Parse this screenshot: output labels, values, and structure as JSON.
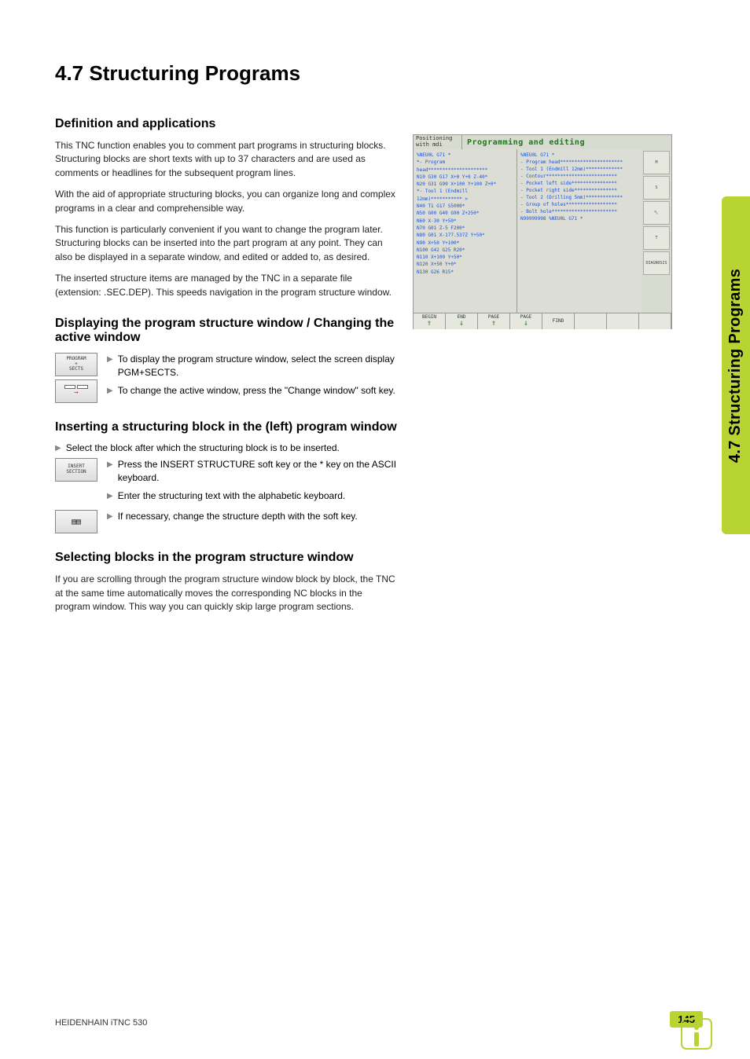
{
  "side_tab": "4.7 Structuring Programs",
  "h1": "4.7  Structuring Programs",
  "sections": {
    "def": {
      "title": "Definition and applications",
      "p1": "This TNC function enables you to comment part programs in structuring blocks. Structuring blocks are short texts with up to 37 characters and are used as comments or headlines for the subsequent program lines.",
      "p2": "With the aid of appropriate structuring blocks, you can organize long and complex programs in a clear and comprehensible way.",
      "p3": "This function is particularly convenient if you want to change the program later. Structuring blocks can be inserted into the part program at any point. They can also be displayed in a separate window, and edited or added to, as desired.",
      "p4": "The inserted structure items are managed by the TNC in a separate file (extension: .SEC.DEP). This speeds navigation in the program structure window."
    },
    "disp": {
      "title": "Displaying the program structure window / Changing the active window",
      "softkey1": "PROGRAM\n+\nSECTS",
      "items": [
        "To display the program structure window, select the screen display PGM+SECTS.",
        "To change the active window, press the \"Change window\" soft key."
      ]
    },
    "insert": {
      "title": "Inserting a structuring block in the (left) program window",
      "lead": "Select the block after which the structuring block is to be inserted.",
      "softkey1": "INSERT\nSECTION",
      "items": [
        "Press the INSERT STRUCTURE soft key or the * key on the ASCII keyboard.",
        "Enter the structuring text with the alphabetic keyboard.",
        "If necessary, change the structure depth with the soft key."
      ]
    },
    "select": {
      "title": "Selecting blocks in the program structure window",
      "p1": "If you are scrolling through the program structure window block by block, the TNC at the same time automatically moves the corresponding NC blocks in the program window. This way you can quickly skip large program sections."
    }
  },
  "footer": {
    "product": "HEIDENHAIN iTNC 530",
    "page": "145"
  },
  "screenshot": {
    "mode": "Positioning with mdi",
    "title": "Programming and editing",
    "left_lines": [
      "%NEU0L G71 *",
      "*- Program head*********************",
      "N10 G30 G17 X+0 Y+0 Z-40*",
      "N20 G31 G90 X+100 Y+100 Z+0*",
      "*- Tool 1 (Endmill 12mm)*********** >",
      "N40 T1 G17 S5000*",
      "N50 G00 G40 G90 Z+250*",
      "N60 X-30 Y+50*",
      "N70 G01 Z-5 F200*",
      "N80 G01 X-177.537Z Y+50*",
      "N90 X+50 Y+100*",
      "N100 G42 G25 R20*",
      "N110 X+100 Y+50*",
      "N120 X+50 Y+0*",
      "N130 G26 R15*"
    ],
    "mid_lines": [
      "%NEU0L G71 *",
      "- Program head**********************",
      "- Tool 1 (Endmill 12mm)*************",
      "  - Contour*************************",
      "  - Pocket left side****************",
      "  - Pocket right side***************",
      "- Tool 2 (Drilling 5mm)*************",
      "  - Group of holes******************",
      "  - Bolt hole***********************",
      "N99999998 %NEU0L G71 *"
    ],
    "right_buttons": [
      "M",
      "S",
      "🔧",
      "T",
      "DIAGNOSIS"
    ],
    "bottom_buttons": [
      "BEGIN",
      "END",
      "PAGE",
      "PAGE",
      "FIND",
      "",
      "",
      ""
    ]
  }
}
